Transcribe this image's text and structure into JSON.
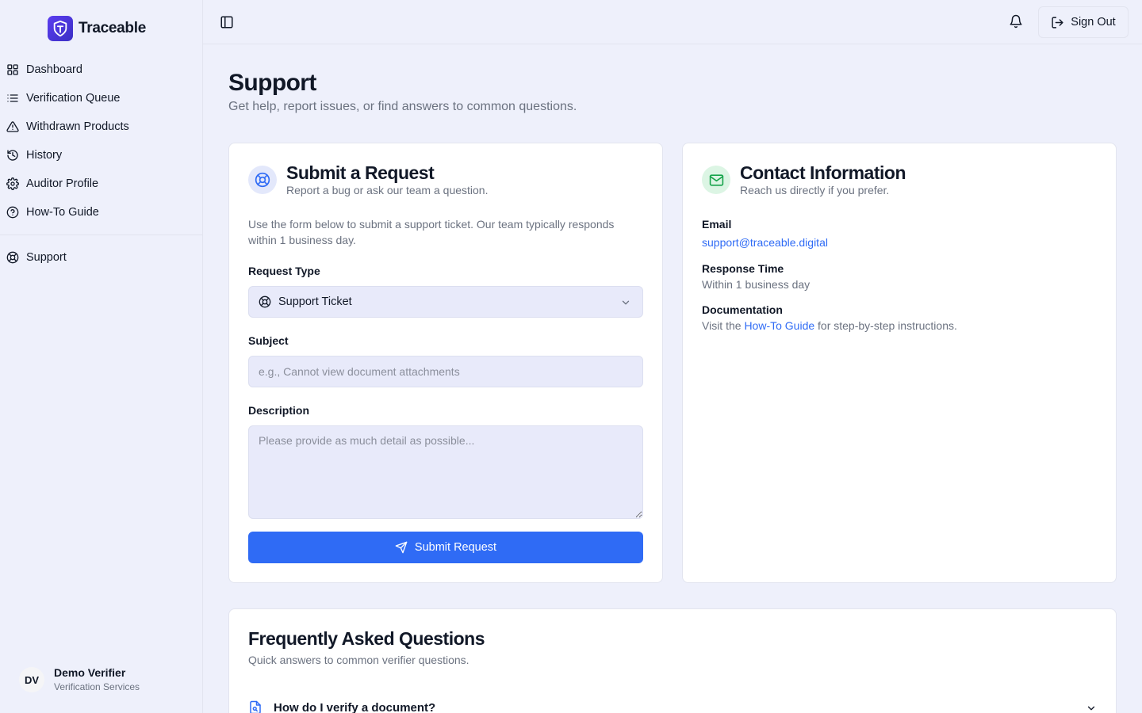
{
  "app": {
    "name": "Traceable"
  },
  "sidebar": {
    "items": [
      {
        "label": "Dashboard",
        "icon": "grid-icon"
      },
      {
        "label": "Verification Queue",
        "icon": "list-icon"
      },
      {
        "label": "Withdrawn Products",
        "icon": "alert-triangle-icon"
      },
      {
        "label": "History",
        "icon": "history-icon"
      },
      {
        "label": "Auditor Profile",
        "icon": "gear-icon"
      },
      {
        "label": "How-To Guide",
        "icon": "help-circle-icon"
      }
    ],
    "secondary": [
      {
        "label": "Support",
        "icon": "life-buoy-icon"
      }
    ],
    "user": {
      "initials": "DV",
      "name": "Demo Verifier",
      "org": "Verification Services"
    }
  },
  "topbar": {
    "signout_label": "Sign Out"
  },
  "page": {
    "title": "Support",
    "subtitle": "Get help, report issues, or find answers to common questions."
  },
  "request_card": {
    "title": "Submit a Request",
    "subtitle": "Report a bug or ask our team a question.",
    "intro": "Use the form below to submit a support ticket. Our team typically responds within 1 business day.",
    "request_type_label": "Request Type",
    "request_type_value": "Support Ticket",
    "subject_label": "Subject",
    "subject_placeholder": "e.g., Cannot view document attachments",
    "description_label": "Description",
    "description_placeholder": "Please provide as much detail as possible...",
    "submit_label": "Submit Request"
  },
  "contact_card": {
    "title": "Contact Information",
    "subtitle": "Reach us directly if you prefer.",
    "email_label": "Email",
    "email_value": "support@traceable.digital",
    "response_label": "Response Time",
    "response_value": "Within 1 business day",
    "docs_label": "Documentation",
    "docs_prefix": "Visit the ",
    "docs_link": "How-To Guide",
    "docs_suffix": " for step-by-step instructions."
  },
  "faq": {
    "title": "Frequently Asked Questions",
    "subtitle": "Quick answers to common verifier questions.",
    "items": [
      {
        "question": "How do I verify a document?"
      }
    ]
  },
  "colors": {
    "background": "#eef0fb",
    "primary": "#2f6bf5",
    "brand": "#4f39e6",
    "success": "#16a34a"
  }
}
